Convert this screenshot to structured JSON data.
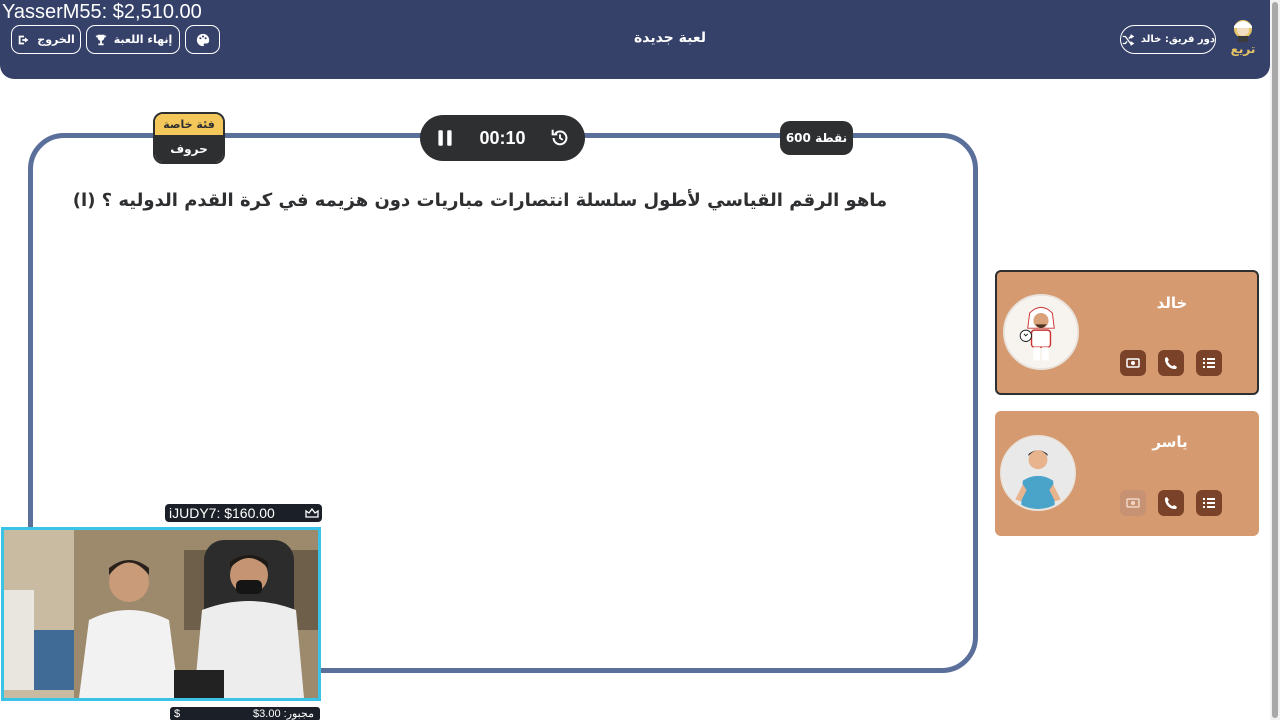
{
  "overlay": {
    "top_donation": "YasserM55: $2,510.00",
    "cam_top_donation": "iJUDY7: $160.00",
    "cam_bottom_label": "مجبور: 3.00$",
    "cam_bottom_currency": "$"
  },
  "header": {
    "exit_label": "الخروج",
    "end_game_label": "إنهاء اللعبة",
    "title": "لعبة جديدة",
    "turn_label": "دور فريق: خالد",
    "logo_text": "تريع"
  },
  "board": {
    "timer": "00:10",
    "points": "600 نقطة",
    "category_tag": "فئة خاصة",
    "category_name": "حروف",
    "question": "ماهو الرقم القياسي لأطول سلسلة انتصارات مباريات دون هزيمه في كرة القدم الدوليه ؟ (ا)"
  },
  "teams": [
    {
      "name": "خالد",
      "active": true
    },
    {
      "name": "ياسر",
      "active": false
    }
  ],
  "colors": {
    "header_bg": "#36416a",
    "board_border": "#5b6f9b",
    "card_bg": "#d69a70",
    "lifeline_bg": "#7a4228",
    "dark": "#2e2f31",
    "accent_yellow": "#f4c75a",
    "cam_border": "#39c3e6"
  }
}
